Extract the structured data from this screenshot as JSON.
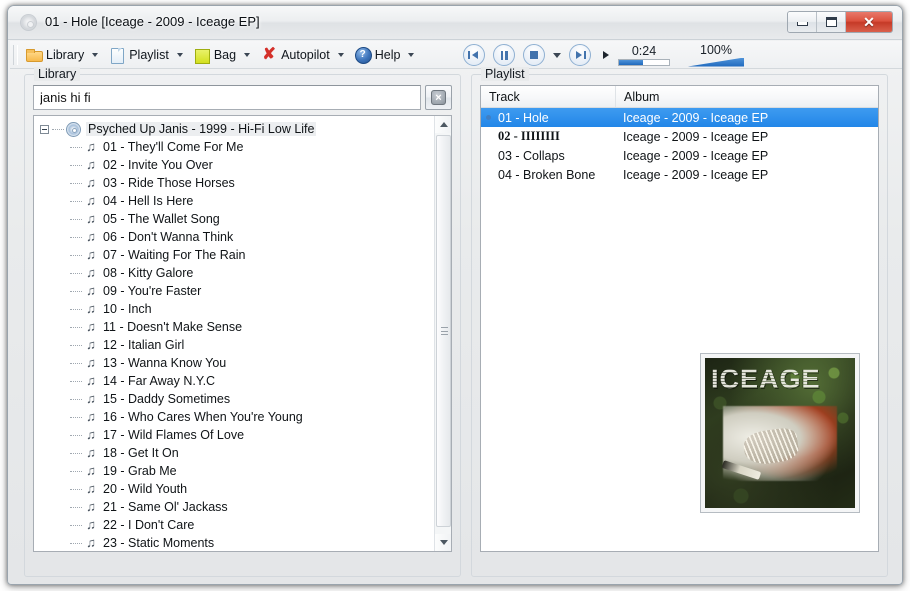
{
  "window": {
    "title": "01 - Hole [Iceage - 2009 - Iceage EP]",
    "icon": "disc-icon",
    "minimize_label": "Minimize",
    "maximize_label": "Maximize",
    "close_label": "✕"
  },
  "toolbar": {
    "items": [
      {
        "label": "Library",
        "accel": "L",
        "icon": "folder-icon",
        "has_dropdown": true
      },
      {
        "label": "Playlist",
        "accel": "P",
        "icon": "page-icon",
        "has_dropdown": true
      },
      {
        "label": "Bag",
        "accel": "g",
        "icon": "bag-icon",
        "has_dropdown": true
      },
      {
        "label": "Autopilot",
        "accel": "A",
        "icon": "red-x-icon",
        "has_dropdown": true
      },
      {
        "label": "Help",
        "accel": "H",
        "icon": "help-icon",
        "has_dropdown": true
      }
    ]
  },
  "transport": {
    "previous_label": "Previous",
    "pause_label": "Pause",
    "stop_label": "Stop",
    "stop_has_dropdown": true,
    "next_label": "Next",
    "play_label": "Play",
    "time": "0:24",
    "seek_percent": 47,
    "volume": "100%",
    "volume_percent": 100
  },
  "library": {
    "group_title": "Library",
    "search_value": "janis hi fi",
    "search_placeholder": "",
    "clear_label": "×",
    "tree": {
      "album_node": "Psyched Up Janis - 1999 - Hi-Fi Low Life",
      "expanded": true,
      "tracks": [
        "01 - They'll Come For Me",
        "02 - Invite You Over",
        "03 - Ride Those Horses",
        "04 - Hell Is Here",
        "05 - The Wallet Song",
        "06 - Don't Wanna Think",
        "07 - Waiting For The Rain",
        "08 - Kitty Galore",
        "09 - You're Faster",
        "10 - Inch",
        "11 - Doesn't Make Sense",
        "12 - Italian Girl",
        "13 - Wanna Know You",
        "14 - Far Away N.Y.C",
        "15 - Daddy Sometimes",
        "16 - Who Cares When You're Young",
        "17 - Wild Flames Of Love",
        "18 - Get It On",
        "19 - Grab Me",
        "20 - Wild Youth",
        "21 - Same Ol' Jackass",
        "22 - I Don't Care",
        "23 - Static Moments"
      ]
    }
  },
  "playlist": {
    "group_title": "Playlist",
    "columns": [
      "Track",
      "Album"
    ],
    "rows": [
      {
        "track": "01 - Hole",
        "album": "Iceage - 2009 - Iceage EP",
        "selected": true,
        "now_playing": true
      },
      {
        "track": "02 - IIIIIIII",
        "album": "Iceage - 2009 - Iceage EP",
        "selected": false,
        "now_playing": false
      },
      {
        "track": "03 - Collaps",
        "album": "Iceage - 2009 - Iceage EP",
        "selected": false,
        "now_playing": false
      },
      {
        "track": "04 - Broken Bone",
        "album": "Iceage - 2009 - Iceage EP",
        "selected": false,
        "now_playing": false
      }
    ],
    "album_art": {
      "name": "album-art",
      "text": "ICEAGE"
    }
  },
  "colors": {
    "selection_blue": "#2286e8",
    "accent_blue": "#1f69bd",
    "close_red": "#c53a27",
    "folder_orange": "#f7b94c",
    "bag_yellow": "#d3e01f",
    "autopilot_red": "#d4302a"
  }
}
